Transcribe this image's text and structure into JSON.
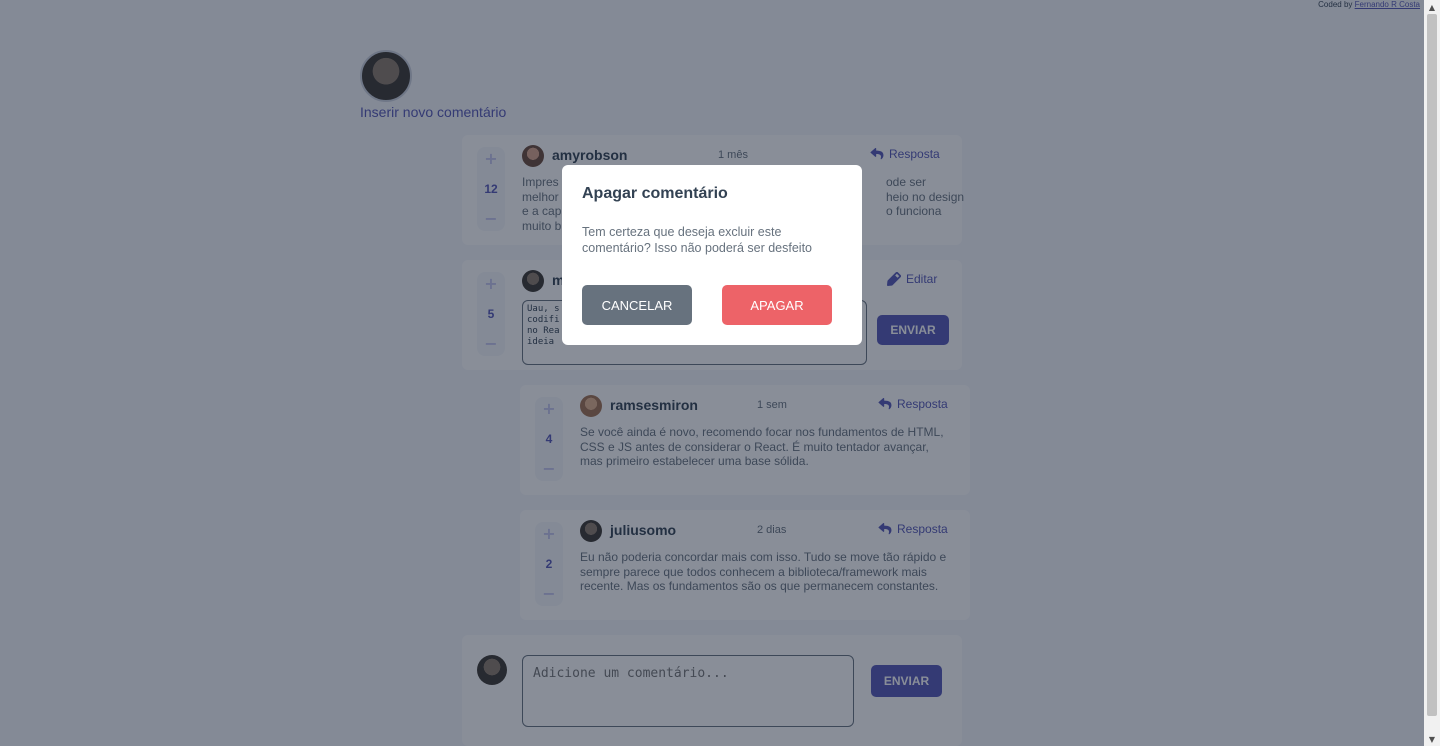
{
  "credit": {
    "prefix": "Coded by ",
    "author": "Fernando R Costa"
  },
  "new_comment_link": "Inserir novo comentário",
  "comments": [
    {
      "user": "amyrobson",
      "time": "1 mês",
      "score": "12",
      "action": "Resposta",
      "text_lines": [
        "Impres",
        "melhor",
        "e a cap",
        "muito b"
      ],
      "text_right": [
        "ode ser",
        "heio no design",
        "o funciona",
        ""
      ]
    },
    {
      "user": "m",
      "score": "5",
      "action": "Editar",
      "edit_lines": [
        "Uau, s",
        "codifi",
        "no Rea",
        "ideia"
      ],
      "send": "ENVIAR"
    },
    {
      "user": "ramsesmiron",
      "time": "1 sem",
      "score": "4",
      "action": "Resposta",
      "text": "Se você ainda é novo, recomendo focar nos fundamentos de HTML, CSS e JS antes de considerar o React. É muito tentador avançar, mas primeiro estabelecer uma base sólida."
    },
    {
      "user": "juliusomo",
      "time": "2 dias",
      "score": "2",
      "action": "Resposta",
      "text": "Eu não poderia concordar mais com isso. Tudo se move tão rápido e sempre parece que todos conhecem a biblioteca/framework mais recente. Mas os fundamentos são os que permanecem constantes."
    }
  ],
  "add_comment": {
    "placeholder": "Adicione um comentário...",
    "send": "ENVIAR"
  },
  "vote": {
    "plus": "+",
    "minus": "−"
  },
  "modal": {
    "title": "Apagar comentário",
    "text": "Tem certeza que deseja excluir este comentário? Isso não poderá ser desfeito",
    "cancel": "CANCELAR",
    "confirm": "APAGAR"
  },
  "colors": {
    "primary": "#5457b6",
    "danger": "#ed6368",
    "neutral": "#67727e",
    "background": "#f5f6fa"
  }
}
